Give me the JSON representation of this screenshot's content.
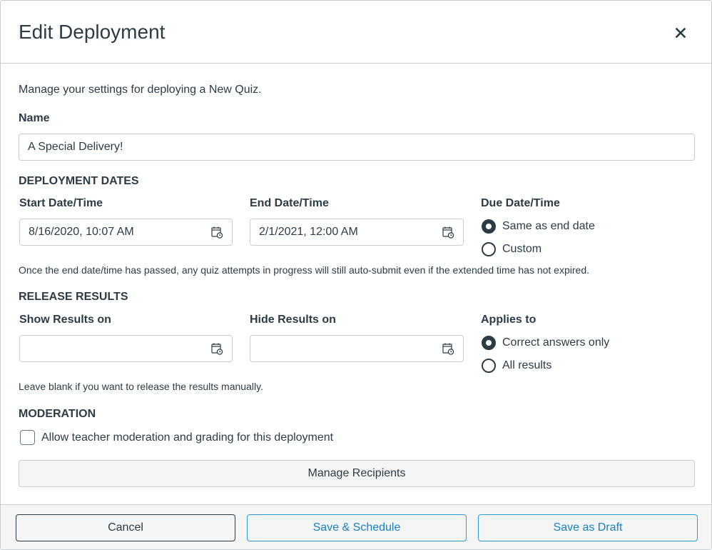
{
  "dialog": {
    "title": "Edit Deployment",
    "close_icon": "close-icon",
    "intro": "Manage your settings for deploying a New Quiz."
  },
  "name_field": {
    "label": "Name",
    "value": "A Special Delivery!"
  },
  "deployment_dates": {
    "heading": "DEPLOYMENT DATES",
    "start": {
      "label": "Start Date/Time",
      "value": "8/16/2020, 10:07 AM",
      "icon": "calendar-clock-icon"
    },
    "end": {
      "label": "End Date/Time",
      "value": "2/1/2021, 12:00 AM",
      "icon": "calendar-clock-icon"
    },
    "due": {
      "label": "Due Date/Time",
      "options": [
        {
          "label": "Same as end date",
          "checked": true
        },
        {
          "label": "Custom",
          "checked": false
        }
      ]
    },
    "help": "Once the end date/time has passed, any quiz attempts in progress will still auto-submit even if the extended time has not expired."
  },
  "release_results": {
    "heading": "RELEASE RESULTS",
    "show": {
      "label": "Show Results on",
      "value": "",
      "icon": "calendar-clock-icon"
    },
    "hide": {
      "label": "Hide Results on",
      "value": "",
      "icon": "calendar-clock-icon"
    },
    "applies_to": {
      "label": "Applies to",
      "options": [
        {
          "label": "Correct answers only",
          "checked": true
        },
        {
          "label": "All results",
          "checked": false
        }
      ]
    },
    "help": "Leave blank if you want to release the results manually."
  },
  "moderation": {
    "heading": "MODERATION",
    "checkbox_label": "Allow teacher moderation and grading for this deployment",
    "checked": false
  },
  "manage_recipients_label": "Manage Recipients",
  "footer": {
    "cancel": "Cancel",
    "save_schedule": "Save & Schedule",
    "save_draft": "Save as Draft"
  },
  "colors": {
    "text": "#2d3b45",
    "border": "#c7cdd1",
    "primary": "#1482c8",
    "footer_bg": "#f5f5f5"
  }
}
